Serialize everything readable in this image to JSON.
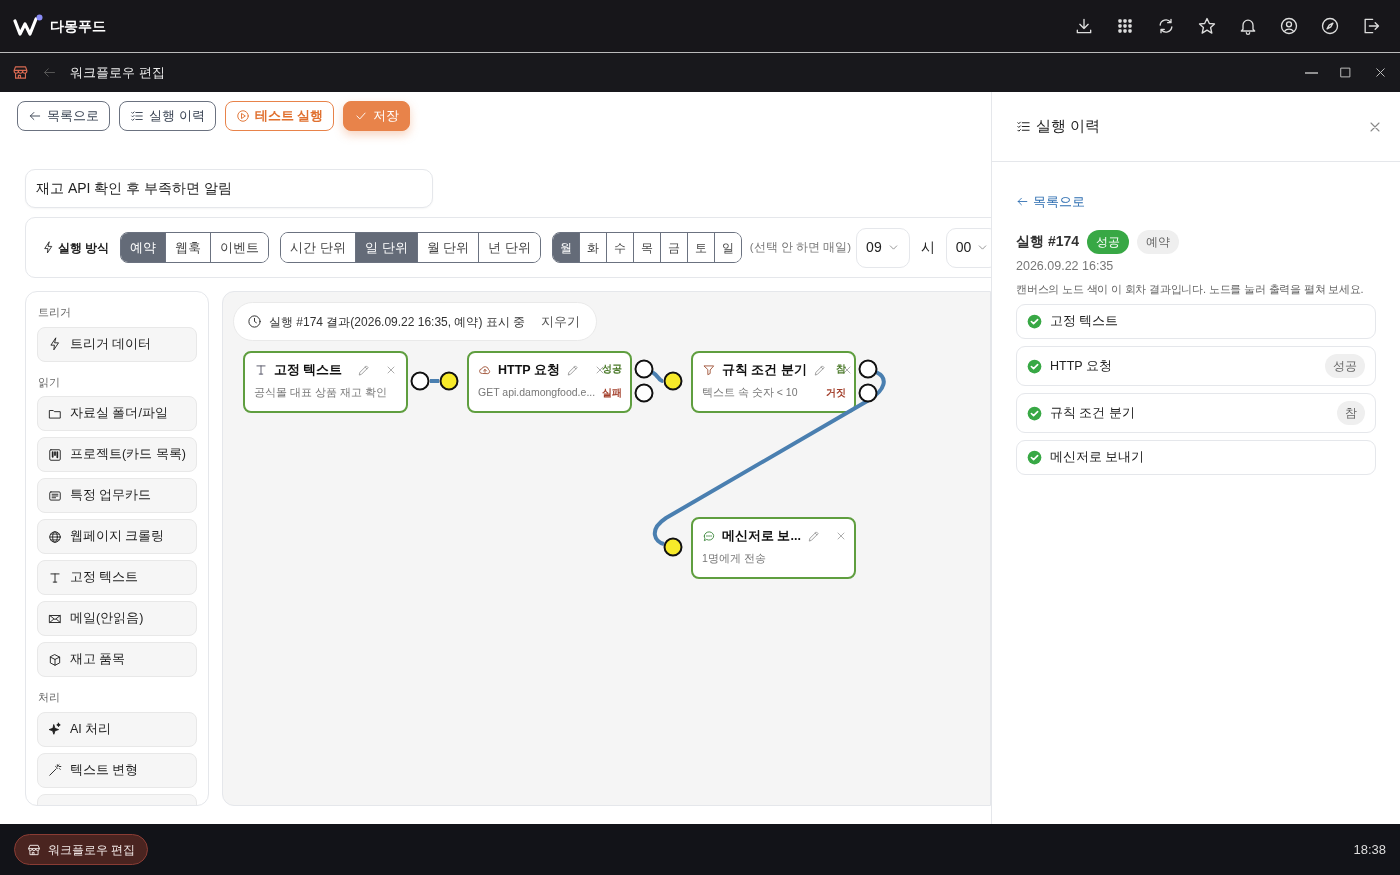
{
  "app": {
    "name": "다몽푸드"
  },
  "window": {
    "title": "워크플로우 편집"
  },
  "toolbar": {
    "buttons": [
      {
        "label": "목록으로",
        "kind": "back"
      },
      {
        "label": "실행 이력",
        "kind": "history"
      },
      {
        "label": "테스트 실행",
        "kind": "test"
      },
      {
        "label": "저장",
        "kind": "save"
      }
    ]
  },
  "workflow_name": {
    "value": "재고 API 확인 후 부족하면 알림"
  },
  "trigger_settings": {
    "label": "실행 방식",
    "modes": [
      {
        "label": "예약",
        "selected": true
      },
      {
        "label": "웹훅",
        "selected": false
      },
      {
        "label": "이벤트",
        "selected": false
      }
    ],
    "units": [
      {
        "label": "시간 단위",
        "selected": false
      },
      {
        "label": "일 단위",
        "selected": true
      },
      {
        "label": "월 단위",
        "selected": false
      },
      {
        "label": "년 단위",
        "selected": false
      }
    ],
    "days": [
      {
        "label": "월",
        "selected": true
      },
      {
        "label": "화",
        "selected": false
      },
      {
        "label": "수",
        "selected": false
      },
      {
        "label": "목",
        "selected": false
      },
      {
        "label": "금",
        "selected": false
      },
      {
        "label": "토",
        "selected": false
      },
      {
        "label": "일",
        "selected": false
      }
    ],
    "hint": "(선택 안 하면 매일)",
    "hour": "09",
    "hour_label": "시",
    "minute": "00"
  },
  "palette": {
    "sections": [
      {
        "title": "트리거",
        "items": [
          {
            "label": "트리거 데이터"
          }
        ]
      },
      {
        "title": "읽기",
        "items": [
          {
            "label": "자료실 폴더/파일"
          },
          {
            "label": "프로젝트(카드 목록)"
          },
          {
            "label": "특정 업무카드"
          },
          {
            "label": "웹페이지 크롤링"
          },
          {
            "label": "고정 텍스트"
          },
          {
            "label": "메일(안읽음)"
          },
          {
            "label": "재고 품목"
          }
        ]
      },
      {
        "title": "처리",
        "items": [
          {
            "label": "AI 처리"
          },
          {
            "label": "텍스트 변형"
          }
        ]
      }
    ],
    "more_below": true
  },
  "canvas": {
    "banner": {
      "text": "실행 #174 결과(2026.09.22 16:35, 예약) 표시 중",
      "action": "지우기"
    },
    "nodes": [
      {
        "title": "고정 텍스트",
        "subtitle": "공식몰 대표 상품 재고 확인",
        "succeeded": true,
        "outputs": [
          {
            "kind": "plain"
          }
        ]
      },
      {
        "title": "HTTP 요청",
        "subtitle": "GET api.damongfood.e...",
        "succeeded": true,
        "input_connected": true,
        "outputs": [
          {
            "label": "성공",
            "kind": "ok"
          },
          {
            "label": "실패",
            "kind": "fail"
          }
        ]
      },
      {
        "title": "규칙 조건 분기",
        "subtitle": "텍스트 속 숫자 < 10",
        "succeeded": true,
        "input_connected": true,
        "outputs": [
          {
            "label": "참",
            "kind": "ok"
          },
          {
            "label": "거짓",
            "kind": "fail"
          }
        ]
      },
      {
        "title": "메신저로 보...",
        "subtitle": "1명에게 전송",
        "succeeded": true,
        "input_connected": true
      }
    ]
  },
  "history_panel": {
    "title": "실행 이력",
    "back_link": "목록으로",
    "run": {
      "title": "실행 #174",
      "status": "성공",
      "succeeded": true,
      "trigger": "예약",
      "date": "2026.09.22 16:35",
      "note": "캔버스의 노드 색이 이 회차 결과입니다. 노드를 눌러 출력을 펼쳐 보세요."
    },
    "steps": [
      {
        "name": "고정 텍스트",
        "succeeded": true
      },
      {
        "name": "HTTP 요청",
        "succeeded": true,
        "tag": "성공"
      },
      {
        "name": "규칙 조건 분기",
        "succeeded": true,
        "tag": "참"
      },
      {
        "name": "메신저로 보내기",
        "succeeded": true
      }
    ]
  },
  "taskbar": {
    "app": "워크플로우 편집",
    "clock": "18:38"
  }
}
